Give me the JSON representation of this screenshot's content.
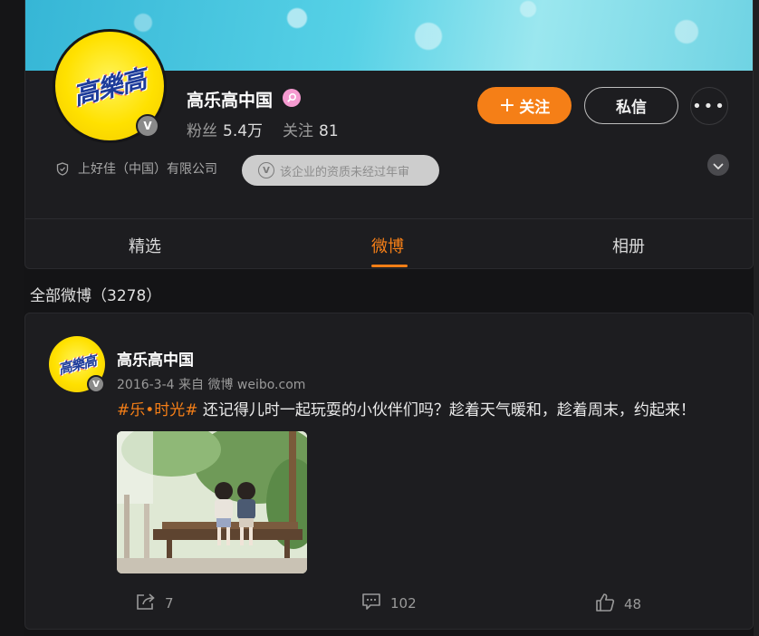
{
  "profile": {
    "logo_text": "高樂高",
    "name": "高乐高中国",
    "fans_label": "粉丝",
    "fans_value": "5.4万",
    "following_label": "关注",
    "following_value": "81",
    "verify_mark": "V",
    "name_badge_icon": "search-badge-icon",
    "company": "上好佳（中国）有限公司",
    "notice": "该企业的资质未经过年审",
    "notice_mark": "V"
  },
  "actions": {
    "follow_plus": "+",
    "follow_label": "关注",
    "message_label": "私信",
    "more_label": "•••"
  },
  "tabs": [
    {
      "label": "精选",
      "active": false
    },
    {
      "label": "微博",
      "active": true
    },
    {
      "label": "相册",
      "active": false
    }
  ],
  "feed": {
    "section_title": "全部微博（3278）"
  },
  "post": {
    "author": "高乐高中国",
    "logo_text": "高樂高",
    "verify_mark": "V",
    "date": "2016-3-4",
    "source": "来自 微博 weibo.com",
    "hashtag": "#乐•时光#",
    "text": " 还记得儿时一起玩耍的小伙伴们吗？趁着天气暖和，趁着周末，约起来！",
    "repost_count": "7",
    "comment_count": "102",
    "like_count": "48"
  },
  "colors": {
    "accent": "#f57f17",
    "background": "#141416",
    "card": "#1d1d20"
  }
}
